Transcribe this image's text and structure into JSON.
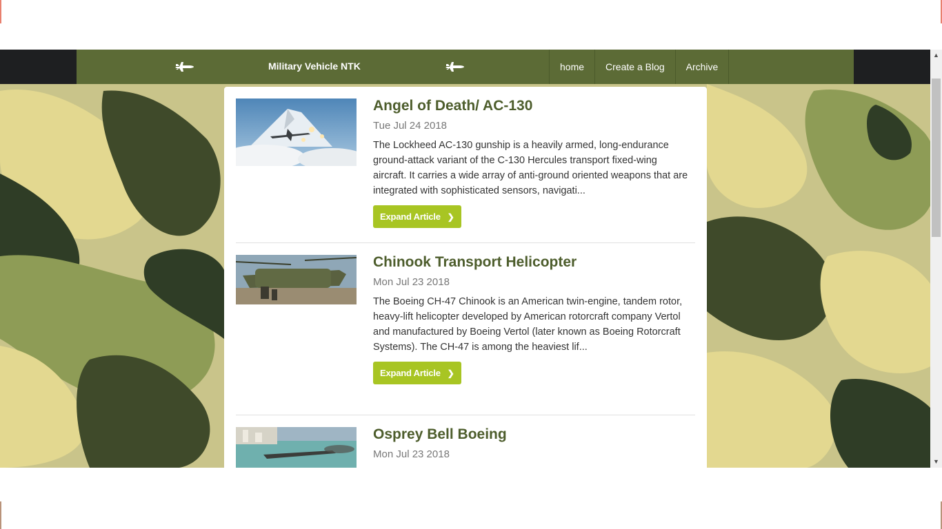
{
  "colors": {
    "nav_bar": "#1e1f21",
    "nav_inner": "#5c6b36",
    "title": "#4d5d2c",
    "button": "#a8c523",
    "camo_light": "#e1d58e",
    "camo_mid": "#8a9a56",
    "camo_dark": "#3f4a2a"
  },
  "nav": {
    "brand": "Military Vehicle NTK",
    "left_icon": "fighter-jet-icon",
    "right_icon": "fighter-jet-icon",
    "links": [
      "home",
      "Create a Blog",
      "Archive"
    ]
  },
  "articles": [
    {
      "title": "Angel of Death/ AC-130",
      "date": "Tue Jul 24 2018",
      "excerpt": "The Lockheed AC-130 gunship is a heavily armed, long-endurance ground-attack variant of the C-130 Hercules transport fixed-wing aircraft. It carries a wide array of anti-ground oriented weapons that are integrated with sophisticated sensors, navigati...",
      "button": "Expand Article"
    },
    {
      "title": "Chinook Transport Helicopter",
      "date": "Mon Jul 23 2018",
      "excerpt": "The Boeing CH-47 Chinook is an American twin-engine, tandem rotor, heavy-lift helicopter developed by American rotorcraft company Vertol and manufactured by Boeing Vertol (later known as Boeing Rotorcraft Systems). The CH-47 is among the heaviest lif...",
      "button": "Expand Article"
    },
    {
      "title": "Osprey Bell Boeing",
      "date": "Mon Jul 23 2018"
    }
  ]
}
